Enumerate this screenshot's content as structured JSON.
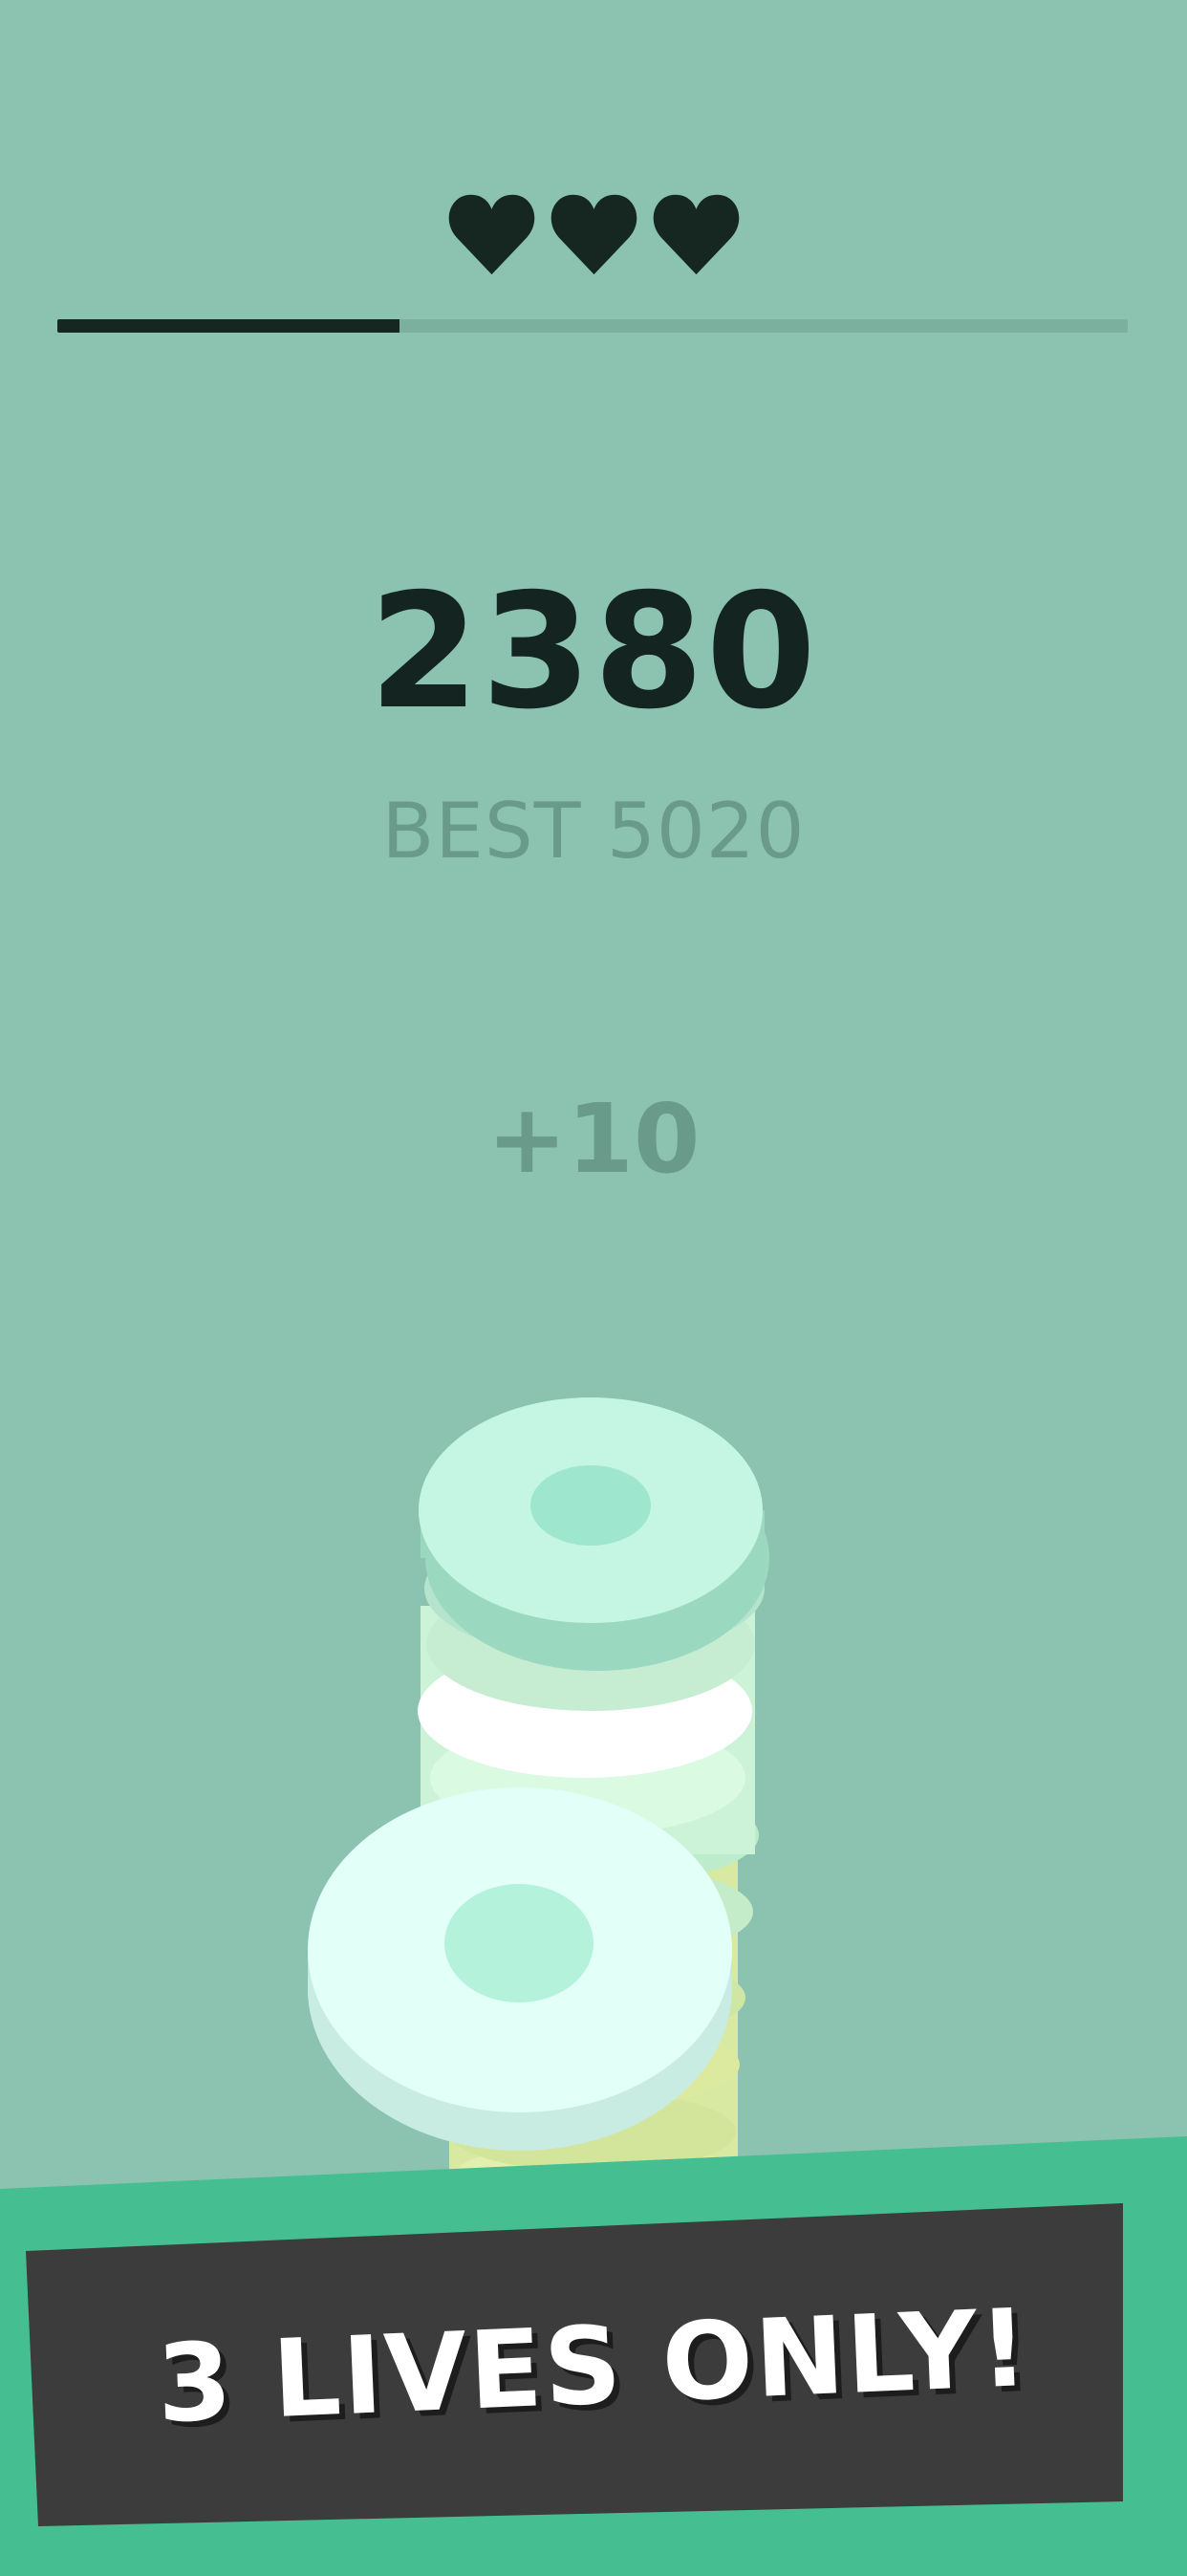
{
  "theme": {
    "background": "#8bc3b0",
    "banner_green": "#45bf92",
    "banner_dark": "#3c3c3c",
    "text_dark": "#142420",
    "text_muted": "#6a9a8a"
  },
  "hud": {
    "lives": 3,
    "life_icon": "heart-icon",
    "level_progress": 0.32,
    "score": "2380",
    "best": "BEST 5020",
    "points_popup": "+10"
  },
  "banner": {
    "text": "3 LIVES ONLY!"
  }
}
